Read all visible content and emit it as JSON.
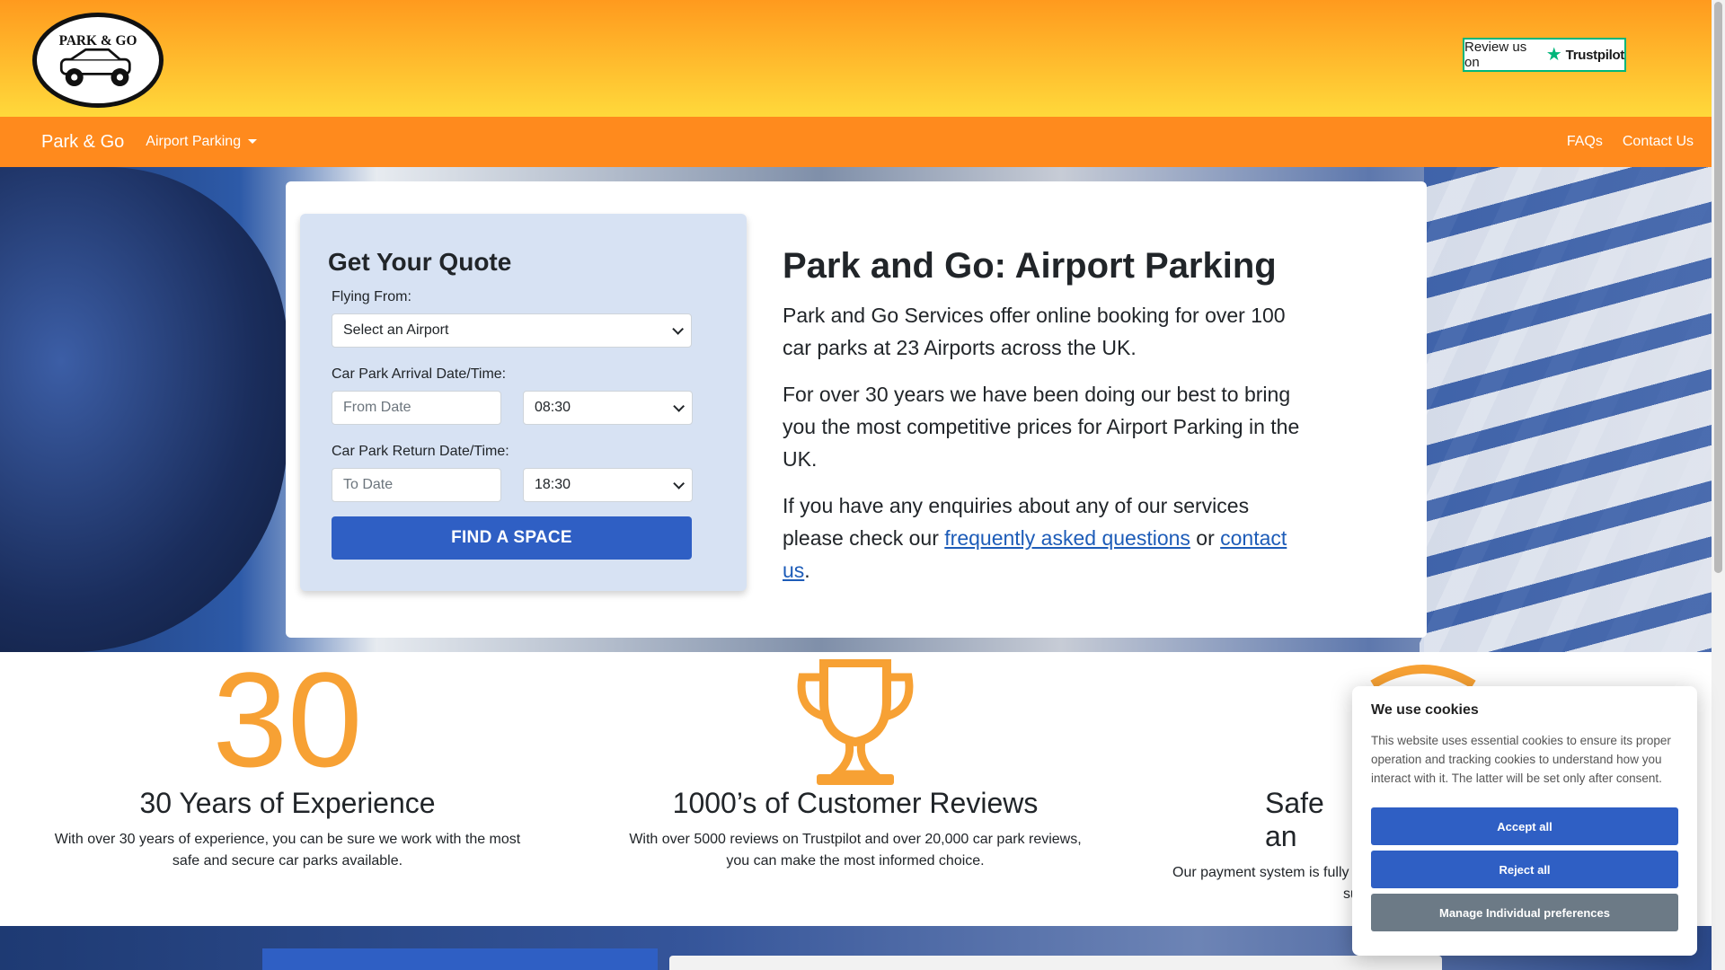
{
  "header": {
    "logo_text": "PARK & GO",
    "trustpilot": {
      "prefix": "Review us on",
      "brand": "Trustpilot"
    }
  },
  "nav": {
    "brand": "Park & Go",
    "dropdown": "Airport Parking",
    "right_links": [
      "FAQs",
      "Contact Us"
    ]
  },
  "quote": {
    "title": "Get Your Quote",
    "flying_from_label": "Flying From:",
    "airport_value": "Select an Airport",
    "arrival_label": "Car Park Arrival Date/Time:",
    "from_date_placeholder": "From Date",
    "arrival_time": "08:30",
    "return_label": "Car Park Return Date/Time:",
    "to_date_placeholder": "To Date",
    "return_time": "18:30",
    "submit": "FIND A SPACE"
  },
  "intro": {
    "title": "Park and Go: Airport Parking",
    "p1": "Park and Go Services offer online booking for over 100 car parks at 23 Airports across the UK.",
    "p2": "For over 30 years we have been doing our best to bring you the most competitive prices for Airport Parking in the UK.",
    "p3_start": "If you have any enquiries about any of our services please check our ",
    "faq_link": "frequently asked questions",
    "p3_mid": " or ",
    "contact_link": "contact us",
    "p3_end": "."
  },
  "features": [
    {
      "big": "30",
      "title": "30 Years of Experience",
      "text": "With over 30 years of experience, you can be sure we work with the most safe and secure car parks available."
    },
    {
      "title": "1000’s of Customer Reviews",
      "text": "With over 5000 reviews on Trustpilot and over 20,000 car park reviews, you can make the most informed choice."
    },
    {
      "title": "Safe an",
      "text_line1": "Our payment system is fully se",
      "text_line2": "sure"
    }
  ],
  "cookie": {
    "title": "We use cookies",
    "text": "This website uses essential cookies to ensure its proper operation and tracking cookies to understand how you interact with it. The latter will be set only after consent.",
    "accept": "Accept all",
    "reject": "Reject all",
    "manage": "Manage Individual preferences"
  },
  "colors": {
    "orange": "#ff8a1d",
    "accent_orange": "#f7a134",
    "blue": "#2f5fc4",
    "trustpilot_green": "#00b67a"
  }
}
